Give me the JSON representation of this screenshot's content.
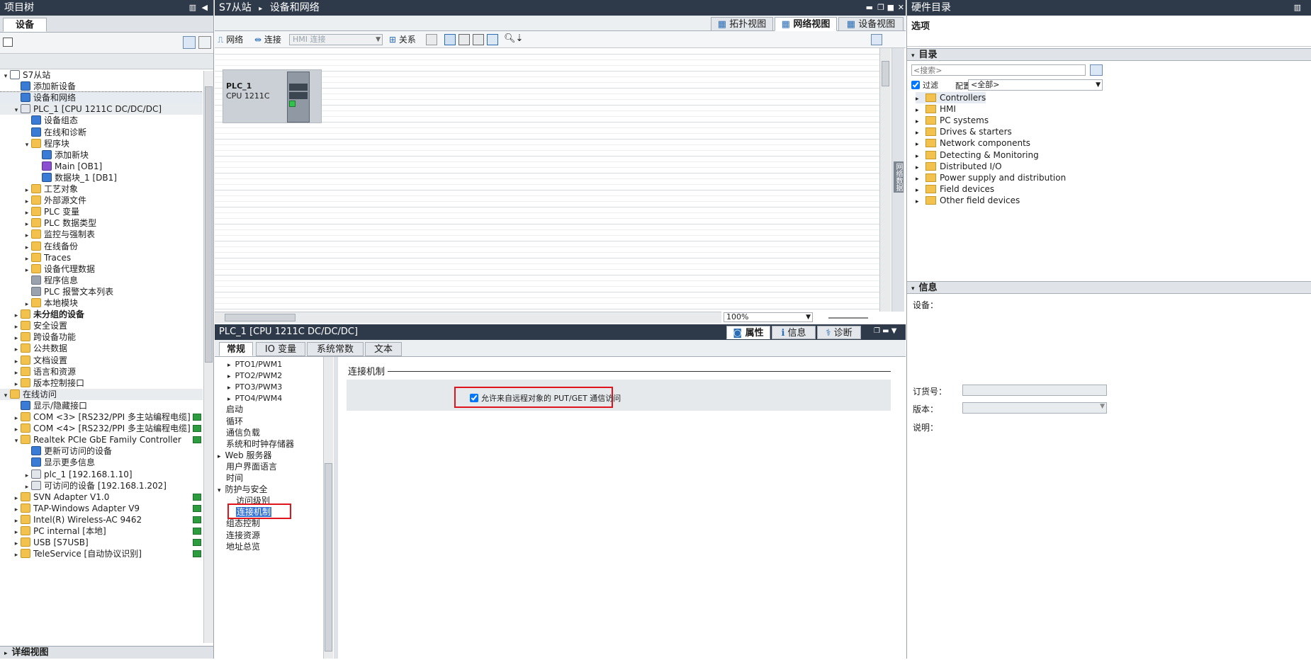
{
  "left_panel": {
    "title": "项目树",
    "tab": "设备",
    "tree": [
      {
        "label": "S7从站",
        "level": 0,
        "arrow": "▾",
        "icon": "doc",
        "bold": false
      },
      {
        "label": "添加新设备",
        "level": 1,
        "arrow": "",
        "icon": "blue",
        "bold": false
      },
      {
        "label": "设备和网络",
        "level": 1,
        "arrow": "",
        "icon": "blue",
        "bold": false,
        "selected": true
      },
      {
        "label": "PLC_1 [CPU 1211C DC/DC/DC]",
        "level": 1,
        "arrow": "▾",
        "icon": "plc",
        "bold": false,
        "header": true
      },
      {
        "label": "设备组态",
        "level": 2,
        "arrow": "",
        "icon": "blue"
      },
      {
        "label": "在线和诊断",
        "level": 2,
        "arrow": "",
        "icon": "blue"
      },
      {
        "label": "程序块",
        "level": 2,
        "arrow": "▾",
        "icon": "folder"
      },
      {
        "label": "添加新块",
        "level": 3,
        "arrow": "",
        "icon": "blue"
      },
      {
        "label": "Main [OB1]",
        "level": 3,
        "arrow": "",
        "icon": "purple"
      },
      {
        "label": "数据块_1 [DB1]",
        "level": 3,
        "arrow": "",
        "icon": "blue"
      },
      {
        "label": "工艺对象",
        "level": 2,
        "arrow": "▸",
        "icon": "folder"
      },
      {
        "label": "外部源文件",
        "level": 2,
        "arrow": "▸",
        "icon": "folder"
      },
      {
        "label": "PLC 变量",
        "level": 2,
        "arrow": "▸",
        "icon": "folder"
      },
      {
        "label": "PLC 数据类型",
        "level": 2,
        "arrow": "▸",
        "icon": "folder"
      },
      {
        "label": "监控与强制表",
        "level": 2,
        "arrow": "▸",
        "icon": "folder"
      },
      {
        "label": "在线备份",
        "level": 2,
        "arrow": "▸",
        "icon": "folder"
      },
      {
        "label": "Traces",
        "level": 2,
        "arrow": "▸",
        "icon": "folder"
      },
      {
        "label": "设备代理数据",
        "level": 2,
        "arrow": "▸",
        "icon": "folder"
      },
      {
        "label": "程序信息",
        "level": 2,
        "arrow": "",
        "icon": "gray"
      },
      {
        "label": "PLC 报警文本列表",
        "level": 2,
        "arrow": "",
        "icon": "gray"
      },
      {
        "label": "本地模块",
        "level": 2,
        "arrow": "▸",
        "icon": "folder"
      },
      {
        "label": "未分组的设备",
        "level": 1,
        "arrow": "▸",
        "icon": "folder",
        "bold": true
      },
      {
        "label": "安全设置",
        "level": 1,
        "arrow": "▸",
        "icon": "folder"
      },
      {
        "label": "跨设备功能",
        "level": 1,
        "arrow": "▸",
        "icon": "folder"
      },
      {
        "label": "公共数据",
        "level": 1,
        "arrow": "▸",
        "icon": "folder"
      },
      {
        "label": "文档设置",
        "level": 1,
        "arrow": "▸",
        "icon": "folder"
      },
      {
        "label": "语言和资源",
        "level": 1,
        "arrow": "▸",
        "icon": "folder"
      },
      {
        "label": "版本控制接口",
        "level": 1,
        "arrow": "▸",
        "icon": "folder"
      },
      {
        "label": "在线访问",
        "level": 0,
        "arrow": "▾",
        "icon": "folder",
        "header": true
      },
      {
        "label": "显示/隐藏接口",
        "level": 1,
        "arrow": "",
        "icon": "blue"
      },
      {
        "label": "COM <3> [RS232/PPI 多主站编程电缆]",
        "level": 1,
        "arrow": "▸",
        "icon": "folder",
        "status": true
      },
      {
        "label": "COM <4> [RS232/PPI 多主站编程电缆]",
        "level": 1,
        "arrow": "▸",
        "icon": "folder",
        "status": true
      },
      {
        "label": "Realtek PCIe GbE Family Controller",
        "level": 1,
        "arrow": "▾",
        "icon": "folder",
        "status": true
      },
      {
        "label": "更新可访问的设备",
        "level": 2,
        "arrow": "",
        "icon": "blue"
      },
      {
        "label": "显示更多信息",
        "level": 2,
        "arrow": "",
        "icon": "blue"
      },
      {
        "label": "plc_1 [192.168.1.10]",
        "level": 2,
        "arrow": "▸",
        "icon": "plc"
      },
      {
        "label": "可访问的设备 [192.168.1.202]",
        "level": 2,
        "arrow": "▸",
        "icon": "plc"
      },
      {
        "label": "SVN Adapter V1.0",
        "level": 1,
        "arrow": "▸",
        "icon": "folder",
        "status": true
      },
      {
        "label": "TAP-Windows Adapter V9",
        "level": 1,
        "arrow": "▸",
        "icon": "folder",
        "status": true
      },
      {
        "label": "Intel(R) Wireless-AC 9462",
        "level": 1,
        "arrow": "▸",
        "icon": "folder",
        "status": true
      },
      {
        "label": "PC internal [本地]",
        "level": 1,
        "arrow": "▸",
        "icon": "folder",
        "status": true
      },
      {
        "label": "USB [S7USB]",
        "level": 1,
        "arrow": "▸",
        "icon": "folder",
        "status": true
      },
      {
        "label": "TeleService [自动协议识别]",
        "level": 1,
        "arrow": "▸",
        "icon": "folder",
        "status": true
      }
    ],
    "details_title": "详细视图"
  },
  "center": {
    "breadcrumb_root": "S7从站",
    "breadcrumb_sep": "▸",
    "breadcrumb_page": "设备和网络",
    "view_tabs": [
      "拓扑视图",
      "网络视图",
      "设备视图"
    ],
    "toolbar": {
      "network": "网络",
      "connection": "连接",
      "connection_type": "HMI 连接",
      "relation": "关系"
    },
    "plc": {
      "name": "PLC_1",
      "cpu": "CPU 1211C"
    },
    "zoom": "100%",
    "side_label": "网络数据"
  },
  "properties": {
    "object_title": "PLC_1 [CPU 1211C DC/DC/DC]",
    "inspector_tabs": [
      "属性",
      "信息",
      "诊断"
    ],
    "tabs": [
      "常规",
      "IO 变量",
      "系统常数",
      "文本"
    ],
    "nav": [
      {
        "label": "PTO1/PWM1",
        "indent": 2,
        "arrow": "▸"
      },
      {
        "label": "PTO2/PWM2",
        "indent": 2,
        "arrow": "▸"
      },
      {
        "label": "PTO3/PWM3",
        "indent": 2,
        "arrow": "▸"
      },
      {
        "label": "PTO4/PWM4",
        "indent": 2,
        "arrow": "▸"
      },
      {
        "label": "启动",
        "indent": 1,
        "arrow": ""
      },
      {
        "label": "循环",
        "indent": 1,
        "arrow": ""
      },
      {
        "label": "通信负载",
        "indent": 1,
        "arrow": ""
      },
      {
        "label": "系统和时钟存储器",
        "indent": 1,
        "arrow": ""
      },
      {
        "label": "Web 服务器",
        "indent": 0,
        "arrow": "▸"
      },
      {
        "label": "用户界面语言",
        "indent": 1,
        "arrow": ""
      },
      {
        "label": "时间",
        "indent": 1,
        "arrow": ""
      },
      {
        "label": "防护与安全",
        "indent": 0,
        "arrow": "▾"
      },
      {
        "label": "访问级别",
        "indent": 2,
        "arrow": ""
      },
      {
        "label": "连接机制",
        "indent": 2,
        "arrow": "",
        "selected": true
      },
      {
        "label": "组态控制",
        "indent": 1,
        "arrow": ""
      },
      {
        "label": "连接资源",
        "indent": 1,
        "arrow": ""
      },
      {
        "label": "地址总览",
        "indent": 1,
        "arrow": ""
      }
    ],
    "section_title": "连接机制",
    "checkbox_label": "允许来自远程对象的 PUT/GET 通信访问",
    "checkbox_checked": true
  },
  "right_panel": {
    "title": "硬件目录",
    "options": "选项",
    "catalog_title": "目录",
    "search_placeholder": "<搜索>",
    "filter_label": "过滤",
    "profile_label": "配置文件",
    "profile_value": "<全部>",
    "catalog": [
      "Controllers",
      "HMI",
      "PC systems",
      "Drives & starters",
      "Network components",
      "Detecting & Monitoring",
      "Distributed I/O",
      "Power supply and distribution",
      "Field devices",
      "Other field devices"
    ],
    "info_title": "信息",
    "device_label": "设备：",
    "order_label": "订货号：",
    "version_label": "版本：",
    "desc_label": "说明："
  },
  "colors": {
    "accent_red": "#e0141d",
    "title_dark": "#2e3a4a",
    "selection": "#3875d7"
  }
}
